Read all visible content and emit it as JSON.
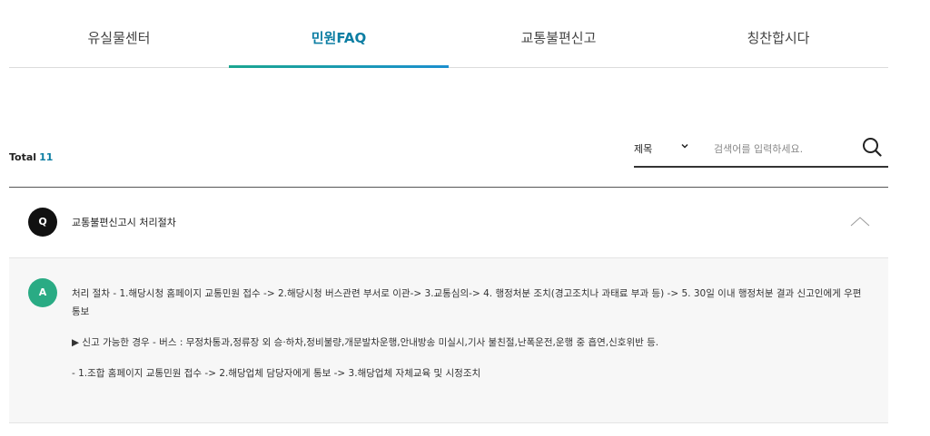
{
  "tabs": [
    {
      "label": "유실물센터",
      "active": false
    },
    {
      "label": "민원FAQ",
      "active": true
    },
    {
      "label": "교통불편신고",
      "active": false
    },
    {
      "label": "칭찬합시다",
      "active": false
    }
  ],
  "total": {
    "label": "Total",
    "count": "11"
  },
  "search": {
    "select_value": "제목",
    "chevron": "⌄",
    "placeholder": "검색어를 입력하세요.",
    "icon": "search-icon"
  },
  "faq": {
    "question_badge": "Q",
    "question": "교통불편신고시 처리절차",
    "answer_badge": "A",
    "answer_paragraphs": [
      "처리 절차 - 1.해당시청 홈페이지 교통민원 접수 -> 2.해당시청 버스관련 부서로 이관-> 3.교통심의-> 4. 행정처분 조치(경고조치나 과태료 부과 등) -> 5. 30일 이내 행정처분 결과 신고인에게 우편 통보",
      "▶ 신고 가능한 경우 - 버스 : 무정차통과,정류장 외 승·하차,정비불량,개문발차운행,안내방송 미실시,기사 불친절,난폭운전,운행 중 흡연,신호위반 등.",
      "- 1.조합 홈페이지 교통민원 접수 -> 2.해당업체 담당자에게 통보 -> 3.해당업체 자체교육 및 시정조치"
    ]
  },
  "colors": {
    "accent": "#0d7ea3",
    "answer_badge": "#2aab84",
    "question_badge": "#111111"
  }
}
